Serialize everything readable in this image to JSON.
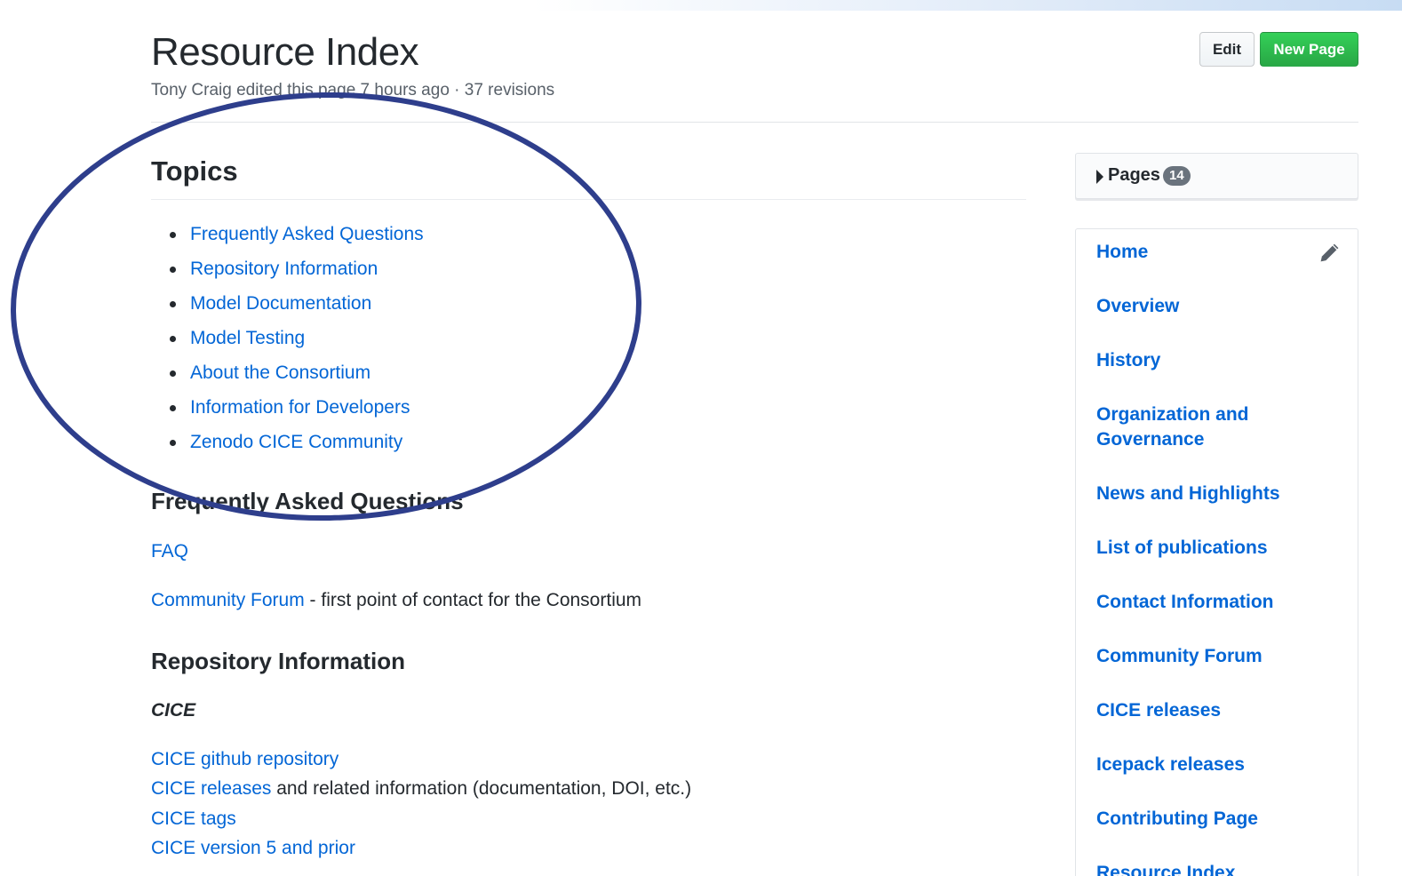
{
  "page": {
    "title": "Resource Index",
    "meta": "Tony Craig edited this page 7 hours ago · 37 revisions"
  },
  "actions": {
    "edit_label": "Edit",
    "new_page_label": "New Page",
    "new_page_color": "#28a745"
  },
  "content": {
    "topics_heading": "Topics",
    "topics": [
      "Frequently Asked Questions",
      "Repository Information",
      "Model Documentation",
      "Model Testing",
      "About the Consortium",
      "Information for Developers",
      "Zenodo CICE Community"
    ],
    "faq_heading": "Frequently Asked Questions",
    "faq_link": "FAQ",
    "forum_link": "Community Forum",
    "forum_text": " - first point of contact for the Consortium",
    "repo_heading": "Repository Information",
    "cice_subheading": "CICE",
    "cice_repo_link": "CICE github repository",
    "cice_releases_link": "CICE releases",
    "cice_releases_text": " and related information (documentation, DOI, etc.)",
    "cice_tags_link": "CICE tags",
    "cice_v5_link": "CICE version 5 and prior"
  },
  "sidebar": {
    "pages_label": "Pages",
    "pages_count": "14",
    "items": [
      "Home",
      "Overview",
      "History",
      "Organization and Governance",
      "News and Highlights",
      "List of publications",
      "Contact Information",
      "Community Forum",
      "CICE releases",
      "Icepack releases",
      "Contributing Page",
      "Resource Index"
    ]
  },
  "annotation": {
    "ellipse_color": "#2e3e8c"
  },
  "colors": {
    "link": "#0366d6",
    "text": "#24292e",
    "muted": "#586069"
  }
}
